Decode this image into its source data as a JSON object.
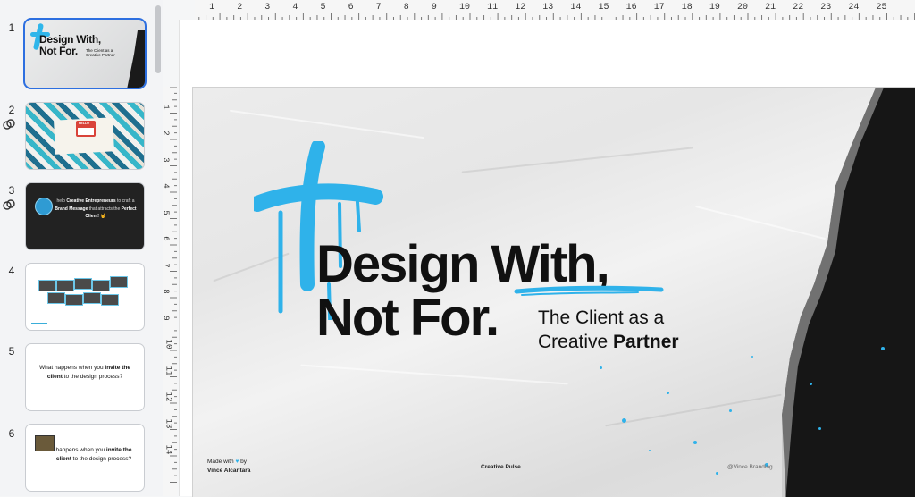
{
  "sidebar": {
    "slides": [
      {
        "number": "1",
        "title_line1": "Design With,",
        "title_line2": "Not For.",
        "subtitle": "The Client as a Creative Partner"
      },
      {
        "number": "2",
        "badge": "HELLO"
      },
      {
        "number": "3",
        "text_pre": "help ",
        "text_b1": "Creative Entrepreneurs",
        "text_mid1": " to craft a ",
        "text_b2": "Brand Message",
        "text_mid2": " that attracts the ",
        "text_b3": "Perfect Client!",
        "emoji": "🤘"
      },
      {
        "number": "4"
      },
      {
        "number": "5",
        "q_pre": "What happens when you ",
        "q_bold": "invite the client",
        "q_post": " to the design process?"
      },
      {
        "number": "6",
        "q_pre": "happens when you ",
        "q_bold": "invite the client",
        "q_post": " to the design process?"
      }
    ]
  },
  "ruler": {
    "top_numbers": [
      "1",
      "2",
      "3",
      "4",
      "5",
      "6",
      "7",
      "8",
      "9",
      "10",
      "11",
      "12",
      "13",
      "14",
      "15",
      "16",
      "17",
      "18",
      "19",
      "20",
      "21",
      "22",
      "23",
      "24",
      "25"
    ],
    "left_numbers": [
      "1",
      "2",
      "3",
      "4",
      "5",
      "6",
      "7",
      "8",
      "9",
      "10",
      "11",
      "12",
      "13",
      "14"
    ]
  },
  "slide": {
    "title_line1": "Design With,",
    "title_line2": "Not For.",
    "subtitle_line1": "The Client as a",
    "subtitle_line2_pre": "Creative ",
    "subtitle_line2_bold": "Partner",
    "footer_made_with": "Made with",
    "footer_by": "by",
    "footer_author": "Vince Alcantara",
    "footer_center": "Creative Pulse",
    "footer_right": "@Vince.Branding",
    "accent_color": "#2fb2ea"
  }
}
